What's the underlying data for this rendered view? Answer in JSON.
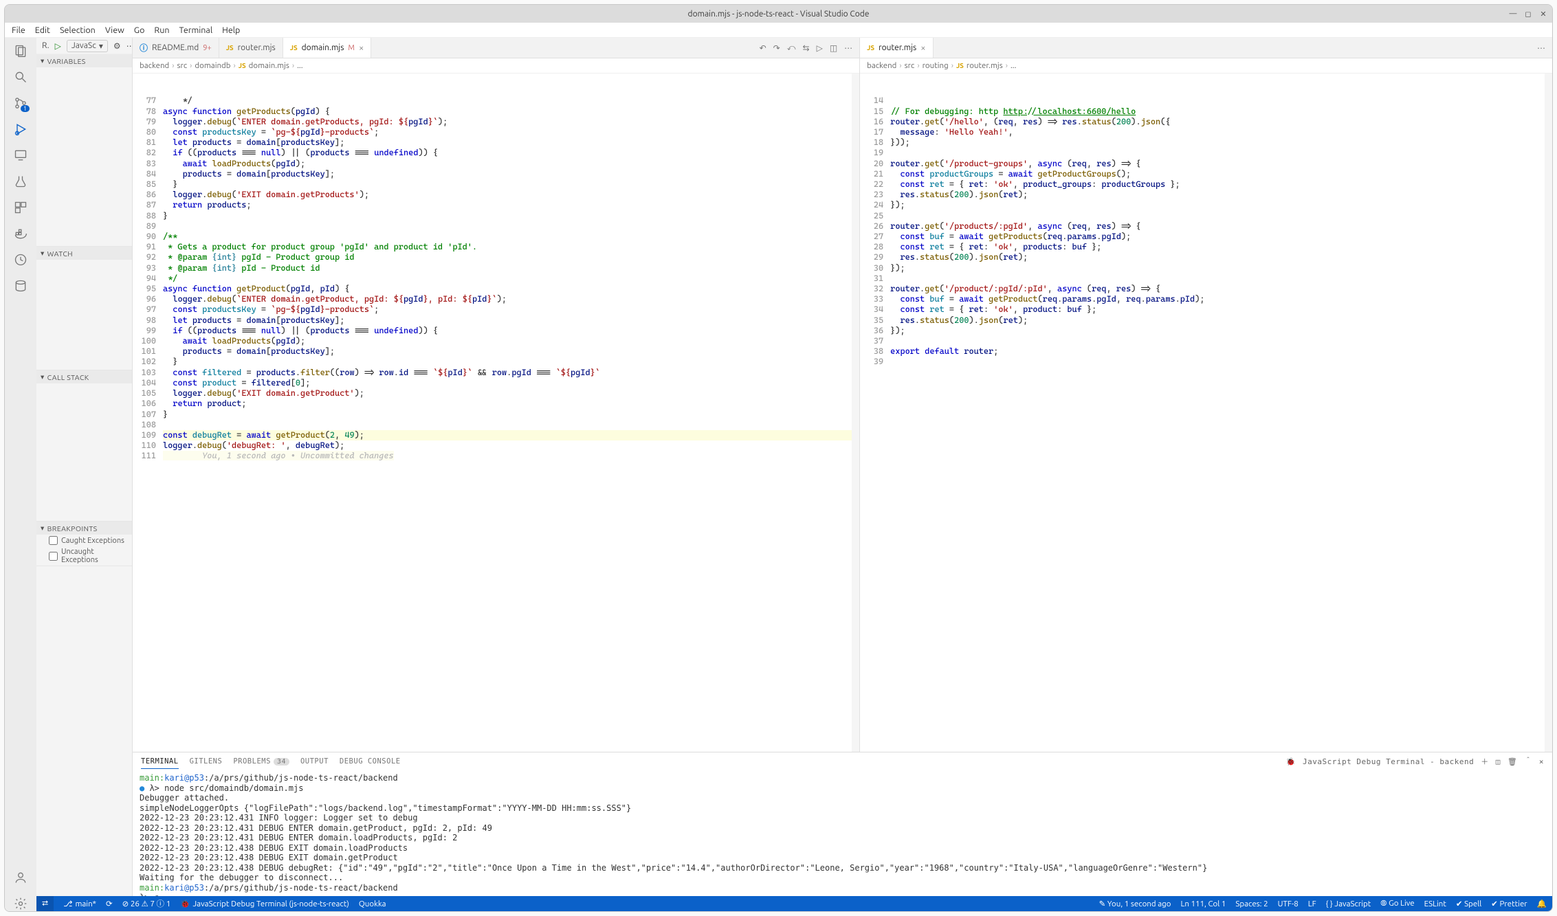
{
  "title": "domain.mjs - js-node-ts-react - Visual Studio Code",
  "menu": [
    "File",
    "Edit",
    "Selection",
    "View",
    "Go",
    "Run",
    "Terminal",
    "Help"
  ],
  "debug": {
    "runLabel": "R.",
    "config": "JavaSc"
  },
  "side": {
    "variables": "VARIABLES",
    "watch": "WATCH",
    "callstack": "CALL STACK",
    "breakpoints": "BREAKPOINTS",
    "bp1": "Caught Exceptions",
    "bp2": "Uncaught Exceptions"
  },
  "tabsL": {
    "t0": {
      "label": "README.md",
      "badge": "9+"
    },
    "t1": {
      "label": "router.mjs"
    },
    "t2": {
      "label": "domain.mjs",
      "mod": "M"
    }
  },
  "tabsR": {
    "t0": {
      "label": "router.mjs"
    }
  },
  "breadL": [
    "backend",
    "src",
    "domaindb",
    "domain.mjs",
    "..."
  ],
  "breadR": [
    "backend",
    "src",
    "routing",
    "router.mjs",
    "..."
  ],
  "codeL": {
    "start": 77,
    "lines": [
      "    */",
      "<kw>async</kw> <kw>function</kw> <fn>getProducts</fn>(<pr>pgId</pr>) {",
      "  <pr>logger</pr>.<fn>debug</fn>(<st>`ENTER domain.getProducts, pgId: ${</st><pr>pgId</pr><st>}`</st>);",
      "  <kw>const</kw> <vr>productsKey</vr> = <st>`pg-${</st><pr>pgId</pr><st>}-products`</st>;",
      "  <kw>let</kw> <pr>products</pr> = <pr>domain</pr>[<pr>productsKey</pr>];",
      "  <kw>if</kw> ((<pr>products</pr> === <kw>null</kw>) || (<pr>products</pr> === <kw>undefined</kw>)) {",
      "    <kw>await</kw> <fn>loadProducts</fn>(<pr>pgId</pr>);",
      "    <pr>products</pr> = <pr>domain</pr>[<pr>productsKey</pr>];",
      "  }",
      "  <pr>logger</pr>.<fn>debug</fn>(<st>'EXIT domain.getProducts'</st>);",
      "  <kw>return</kw> <pr>products</pr>;",
      "}",
      "",
      "<cm>/**</cm>",
      "<cm> * Gets a product for product group 'pgId' and product id 'pId'.</cm>",
      "<cm> * @param </cm><ty>{int}</ty><cm> pgId - Product group id</cm>",
      "<cm> * @param </cm><ty>{int}</ty><cm> pId - Product id</cm>",
      "<cm> */</cm>",
      "<kw>async</kw> <kw>function</kw> <fn>getProduct</fn>(<pr>pgId</pr>, <pr>pId</pr>) {",
      "  <pr>logger</pr>.<fn>debug</fn>(<st>`ENTER domain.getProduct, pgId: ${</st><pr>pgId</pr><st>}, pId: ${</st><pr>pId</pr><st>}`</st>);",
      "  <kw>const</kw> <vr>productsKey</vr> = <st>`pg-${</st><pr>pgId</pr><st>}-products`</st>;",
      "  <kw>let</kw> <pr>products</pr> = <pr>domain</pr>[<pr>productsKey</pr>];",
      "  <kw>if</kw> ((<pr>products</pr> === <kw>null</kw>) || (<pr>products</pr> === <kw>undefined</kw>)) {",
      "    <kw>await</kw> <fn>loadProducts</fn>(<pr>pgId</pr>);",
      "    <pr>products</pr> = <pr>domain</pr>[<pr>productsKey</pr>];",
      "  }",
      "  <kw>const</kw> <vr>filtered</vr> = <pr>products</pr>.<fn>filter</fn>((<pr>row</pr>) => <pr>row</pr>.<pr>id</pr> === <st>`${</st><pr>pId</pr><st>}`</st> && <pr>row</pr>.<pr>pgId</pr> === <st>`${</st><pr>pgId</pr><st>}`</st>",
      "  <kw>const</kw> <vr>product</vr> = <pr>filtered</pr>[<nu>0</nu>];",
      "  <pr>logger</pr>.<fn>debug</fn>(<st>'EXIT domain.getProduct'</st>);",
      "  <kw>return</kw> <pr>product</pr>;",
      "}",
      "",
      "<kw>const</kw> <vr>debugRet</vr> = <kw>await</kw> <fn>getProduct</fn>(<nu>2</nu>, <nu>49</nu>);",
      "<pr>logger</pr>.<fn>debug</fn>(<st>'debugRet: '</st>, <pr>debugRet</pr>);",
      "<gl>        You, 1 second ago • Uncommitted changes</gl>"
    ]
  },
  "codeR": {
    "start": 14,
    "lines": [
      "",
      "<cm>// For debugging: http </cm><u>http://localhost:6600/hello</u>",
      "<pr>router</pr>.<fn>get</fn>(<st>'/hello'</st>, (<pr>req</pr>, <pr>res</pr>) => <pr>res</pr>.<fn>status</fn>(<nu>200</nu>).<fn>json</fn>({",
      "  <pr>message</pr>: <st>'Hello Yeah!'</st>,",
      "}));",
      "",
      "<pr>router</pr>.<fn>get</fn>(<st>'/product-groups'</st>, <kw>async</kw> (<pr>req</pr>, <pr>res</pr>) => {",
      "  <kw>const</kw> <vr>productGroups</vr> = <kw>await</kw> <fn>getProductGroups</fn>();",
      "  <kw>const</kw> <vr>ret</vr> = { <pr>ret</pr>: <st>'ok'</st>, <pr>product_groups</pr>: <pr>productGroups</pr> };",
      "  <pr>res</pr>.<fn>status</fn>(<nu>200</nu>).<fn>json</fn>(<pr>ret</pr>);",
      "});",
      "",
      "<pr>router</pr>.<fn>get</fn>(<st>'/products/:pgId'</st>, <kw>async</kw> (<pr>req</pr>, <pr>res</pr>) => {",
      "  <kw>const</kw> <vr>buf</vr> = <kw>await</kw> <fn>getProducts</fn>(<pr>req</pr>.<pr>params</pr>.<pr>pgId</pr>);",
      "  <kw>const</kw> <vr>ret</vr> = { <pr>ret</pr>: <st>'ok'</st>, <pr>products</pr>: <pr>buf</pr> };",
      "  <pr>res</pr>.<fn>status</fn>(<nu>200</nu>).<fn>json</fn>(<pr>ret</pr>);",
      "});",
      "",
      "<pr>router</pr>.<fn>get</fn>(<st>'/product/:pgId/:pId'</st>, <kw>async</kw> (<pr>req</pr>, <pr>res</pr>) => {",
      "  <kw>const</kw> <vr>buf</vr> = <kw>await</kw> <fn>getProduct</fn>(<pr>req</pr>.<pr>params</pr>.<pr>pgId</pr>, <pr>req</pr>.<pr>params</pr>.<pr>pId</pr>);",
      "  <kw>const</kw> <vr>ret</vr> = { <pr>ret</pr>: <st>'ok'</st>, <pr>product</pr>: <pr>buf</pr> };",
      "  <pr>res</pr>.<fn>status</fn>(<nu>200</nu>).<fn>json</fn>(<pr>ret</pr>);",
      "});",
      "",
      "<kw>export</kw> <kw>default</kw> <pr>router</pr>;",
      ""
    ]
  },
  "panel": {
    "tabs": [
      "TERMINAL",
      "GITLENS",
      "PROBLEMS",
      "OUTPUT",
      "DEBUG CONSOLE"
    ],
    "problems": "34",
    "label": "JavaScript Debug Terminal - backend",
    "lines": [
      "<pr1>main:</pr1><pr2>kari@p53</pr2>:/a/prs/github/js-node-ts-react/backend",
      "<dot>●</dot> λ> node src/domaindb/domain.mjs",
      "Debugger attached.",
      "simpleNodeLoggerOpts {\"logFilePath\":\"logs/backend.log\",\"timestampFormat\":\"YYYY-MM-DD HH:mm:ss.SSS\"}",
      "2022-12-23 20:23:12.431 INFO  logger: Logger set to debug",
      "2022-12-23 20:23:12.431 DEBUG ENTER domain.getProduct, pgId: 2, pId: 49",
      "2022-12-23 20:23:12.431 DEBUG ENTER domain.loadProducts, pgId: 2",
      "2022-12-23 20:23:12.438 DEBUG EXIT domain.loadProducts",
      "2022-12-23 20:23:12.438 DEBUG EXIT domain.getProduct",
      "2022-12-23 20:23:12.438 DEBUG debugRet: {\"id\":\"49\",\"pgId\":\"2\",\"title\":\"Once Upon a Time in the West\",\"price\":\"14.4\",\"authorOrDirector\":\"Leone, Sergio\",\"year\":\"1968\",\"country\":\"Italy-USA\",\"languageOrGenre\":\"Western\"}",
      "Waiting for the debugger to disconnect...",
      "<pr1>main:</pr1><pr2>kari@p53</pr2>:/a/prs/github/js-node-ts-react/backend",
      "  λ> ▮"
    ]
  },
  "status": {
    "branch": "main*",
    "sync": "⟳",
    "err": "⊘ 26 ⚠ 7 ⓘ 1",
    "dbg": "JavaScript Debug Terminal (js-node-ts-react)",
    "quokka": "Quokka",
    "blame": "✎ You, 1 second ago",
    "pos": "Ln 111, Col 1",
    "spaces": "Spaces: 2",
    "enc": "UTF-8",
    "eol": "LF",
    "lang": "{ } JavaScript",
    "live": "⦾ Go Live",
    "eslint": "ESLint",
    "spell": "✔ Spell",
    "prettier": "✔ Prettier",
    "bell": "🔔"
  }
}
